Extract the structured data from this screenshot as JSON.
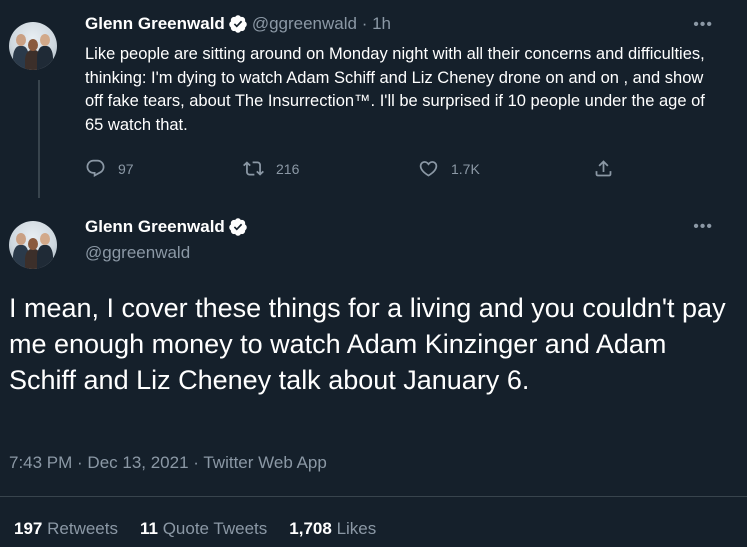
{
  "tweet1": {
    "name": "Glenn Greenwald",
    "handle": "@ggreenwald",
    "separator": " · ",
    "time": "1h",
    "text": "Like people are sitting around on Monday night with all their concerns and difficulties, thinking: I'm dying to watch Adam Schiff and Liz Cheney drone on and on , and show off fake tears, about The Insurrection™. I'll be surprised if 10 people under the age of 65 watch that.",
    "more": "•••",
    "replies": "97",
    "retweets": "216",
    "likes": "1.7K"
  },
  "tweet2": {
    "name": "Glenn Greenwald",
    "handle": "@ggreenwald",
    "more": "•••",
    "text": "I mean, I cover these things for a living and you couldn't pay me enough money to watch Adam Kinzinger and Adam Schiff and Liz Cheney talk about January 6.",
    "timestamp": "7:43 PM · Dec 13, 2021 · Twitter Web App",
    "stats": {
      "retweets_count": "197",
      "retweets_label": "Retweets",
      "quotes_count": "11",
      "quotes_label": "Quote Tweets",
      "likes_count": "1,708",
      "likes_label": "Likes"
    }
  },
  "icons": [
    "verified-badge-icon",
    "reply-icon",
    "retweet-icon",
    "like-icon",
    "share-icon",
    "more-icon"
  ],
  "colors": {
    "background": "#15202b",
    "muted": "#8b98a5",
    "verified": "#ffffff",
    "divider": "#38444d"
  }
}
